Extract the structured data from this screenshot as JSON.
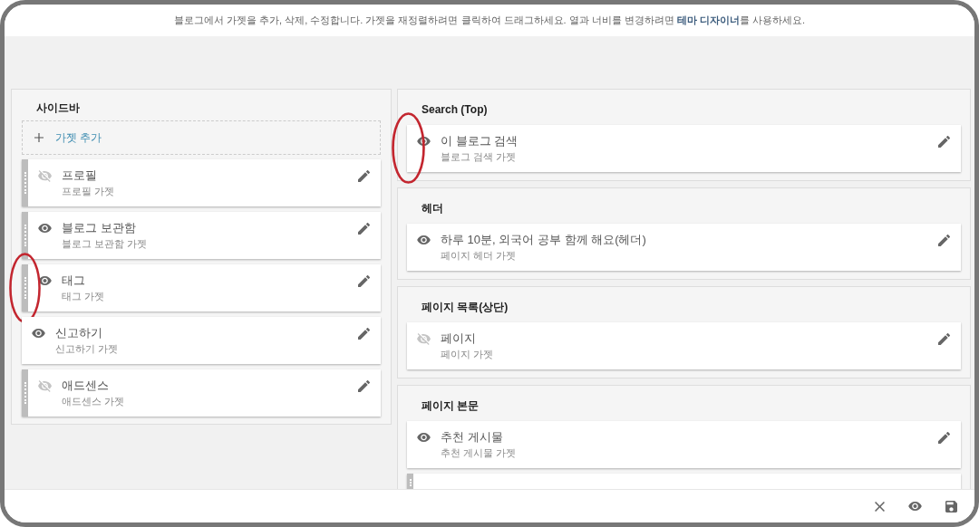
{
  "instruction": {
    "before": "블로그에서 가젯을 추가, 삭제, 수정합니다. 가젯을 재정렬하려면 클릭하여 드래그하세요. 열과 너비를 변경하려면 ",
    "link": "테마 디자이너",
    "after": "를 사용하세요."
  },
  "sidebar": {
    "title": "사이드바",
    "add_gadget": "가젯 추가",
    "gadgets": [
      {
        "kind": "gadget",
        "title": "프로필",
        "subtitle": "프로필 가젯",
        "visible": false,
        "draggable": true,
        "annotated": false
      },
      {
        "kind": "gadget",
        "title": "블로그 보관함",
        "subtitle": "블로그 보관함 가젯",
        "visible": true,
        "draggable": true,
        "annotated": false
      },
      {
        "kind": "gadget",
        "title": "태그",
        "subtitle": "태그 가젯",
        "visible": true,
        "draggable": true,
        "annotated": true
      },
      {
        "kind": "gadget",
        "title": "신고하기",
        "subtitle": "신고하기 가젯",
        "visible": true,
        "draggable": false,
        "annotated": false
      },
      {
        "kind": "gadget",
        "title": "애드센스",
        "subtitle": "애드센스 가젯",
        "visible": false,
        "draggable": true,
        "annotated": false
      }
    ]
  },
  "sections": [
    {
      "title": "Search (Top)",
      "gadgets": [
        {
          "kind": "gadget",
          "title": "이 블로그 검색",
          "subtitle": "블로그 검색 가젯",
          "visible": true,
          "draggable": false,
          "annotated": true
        }
      ]
    },
    {
      "title": "헤더",
      "gadgets": [
        {
          "kind": "gadget",
          "title": "하루 10분, 외국어 공부 함께 해요(헤더)",
          "subtitle": "페이지 헤더 가젯",
          "visible": true,
          "draggable": false,
          "annotated": false
        }
      ]
    },
    {
      "title": "페이지 목록(상단)",
      "gadgets": [
        {
          "kind": "gadget",
          "title": "페이지",
          "subtitle": "페이지 가젯",
          "visible": false,
          "draggable": false,
          "annotated": false
        }
      ]
    },
    {
      "title": "페이지 본문",
      "gadgets": [
        {
          "kind": "gadget",
          "title": "추천 게시물",
          "subtitle": "추천 게시물 가젯",
          "visible": true,
          "draggable": false,
          "annotated": false
        },
        {
          "kind": "cut_off",
          "draggable": true
        }
      ]
    }
  ]
}
